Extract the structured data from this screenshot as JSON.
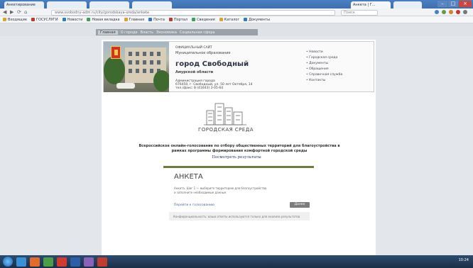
{
  "browser": {
    "tabs": [
      "Анкетирование",
      "",
      "",
      "",
      "Анкета | Г...",
      ""
    ],
    "window_buttons": [
      "–",
      "□",
      "×"
    ],
    "nav_buttons": [
      "◀",
      "▶",
      "⟳",
      "⌂"
    ],
    "url": "www.svobodny-adm.ru/city/gorodskaya-sreda/anketa",
    "search_placeholder": "Поиск",
    "bookmarks": [
      "Входящие",
      "ГОСУСЛУГИ",
      "Новости",
      "Новая вкладка",
      "Главная",
      "Почта",
      "Портал",
      "Сведения",
      "Каталог",
      "Документы"
    ]
  },
  "site_nav": [
    "Главная",
    "О городе",
    "Власть",
    "Экономика",
    "Социальная сфера"
  ],
  "header": {
    "line1": "ОФИЦИАЛЬНЫЙ САЙТ",
    "line2": "Муниципальное образование",
    "city": "город Свободный",
    "region": "Амурской области",
    "contacts1": "Администрация города",
    "contacts2": "676450, г. Свободный, ул. 50 лет Октября, 14",
    "contacts3": "тел./факс: 8 (41643) 3-05-64",
    "nav": [
      "• Новости",
      "• Городская среда",
      "• Документы",
      "• Обращения",
      "• Справочная служба",
      "• Контакты"
    ]
  },
  "logo_text": "ГОРОДСКАЯ СРЕДА",
  "headline": "Всероссийское онлайн-голосование по отбору общественных территорий для благоустройства в рамках программы формирования комфортной городской среды",
  "results_link": "Посмотреть результаты",
  "form": {
    "title": "АНКЕТА",
    "desc1": "Анкета. Шаг 1 — выберите территорию для благоустройства",
    "desc2": "и заполните необходимые данные",
    "field_link": "Перейти к голосованию",
    "next_button": "Далее",
    "footer": "Конфиденциальность: ваши ответы используются только для анализа результатов"
  },
  "taskbar": {
    "clock": "10:24"
  }
}
